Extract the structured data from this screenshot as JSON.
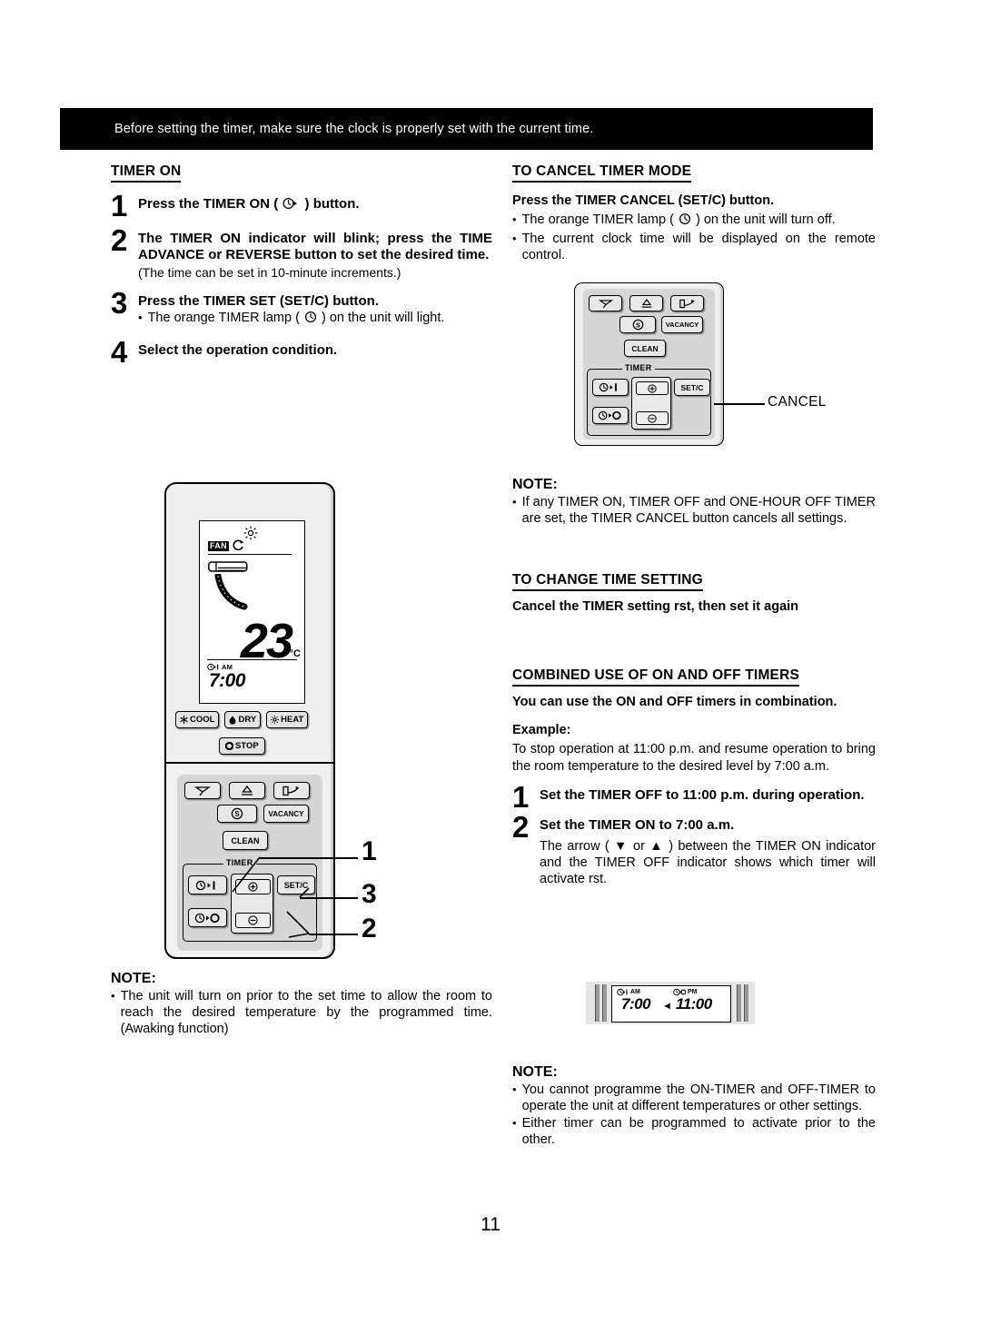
{
  "banner": {
    "text": "Before setting the timer, make sure the clock is properly set with the current time."
  },
  "left": {
    "heading": "TIMER ON",
    "steps": [
      {
        "num": "1",
        "text_before": "Press the TIMER ON (",
        "icon": "timer-on-clock-icon",
        "text_after": ") button.",
        "sub": ""
      },
      {
        "num": "2",
        "text": "The TIMER ON indicator will blink; press the TIME ADVANCE or REVERSE button to set the desired time.",
        "sub": "(The time can be set in 10-minute increments.)"
      },
      {
        "num": "3",
        "text": "Press the TIMER SET (SET/C) button.",
        "sub_before": "The orange TIMER lamp (",
        "sub_icon": "clock-icon",
        "sub_after": ") on the unit will light."
      },
      {
        "num": "4",
        "text": "Select the operation condition.",
        "sub": ""
      }
    ],
    "note": {
      "heading": "NOTE:",
      "bullets": [
        "The unit will turn on prior to the set time to allow the room to reach the desired temperature by the programmed time. (Awaking function)"
      ]
    }
  },
  "right": {
    "cancel_section": {
      "heading": "TO CANCEL TIMER MODE",
      "lead": "Press the TIMER CANCEL (SET/C) button.",
      "bullet1_before": "The orange TIMER lamp (",
      "bullet1_icon": "clock-icon",
      "bullet1_after": ") on the unit will turn off.",
      "bullet2": "The current clock time will be displayed on the remote control."
    },
    "callout_cancel": "CANCEL",
    "note1": {
      "heading": "NOTE:",
      "bullets": [
        "If any TIMER ON, TIMER OFF and ONE-HOUR OFF TIMER are set, the TIMER CANCEL button cancels all settings."
      ]
    },
    "change_section": {
      "heading": "TO CHANGE TIME SETTING",
      "lead": "Cancel the TIMER setting  rst, then set it again"
    },
    "combined_section": {
      "heading": "COMBINED USE OF ON AND OFF TIMERS",
      "lead": "You can use the ON and OFF timers in combination.",
      "example_label": "Example:",
      "example_text": "To stop operation at 11:00 p.m. and resume operation to bring the room temperature to the desired level by 7:00 a.m.",
      "steps": [
        {
          "num": "1",
          "text": "Set the TIMER OFF to 11:00 p.m. during operation.",
          "sub": ""
        },
        {
          "num": "2",
          "text": "Set the TIMER ON to 7:00 a.m.",
          "sub_a": "The arrow (",
          "sub_b": "or",
          "sub_c": ") between the TIMER ON indicator and the TIMER OFF indicator shows which timer will activate  rst."
        }
      ]
    },
    "note2": {
      "heading": "NOTE:",
      "bullets": [
        "You cannot programme the ON-TIMER and OFF-TIMER to operate the unit at different temperatures or other settings.",
        "Either timer can be programmed to activate prior to the other."
      ]
    }
  },
  "remote_big": {
    "lcd": {
      "fan_label": "FAN",
      "temperature": "23",
      "temp_unit": "°C",
      "timer_am_label": "AM",
      "timer_time": "7:00"
    },
    "mode_buttons": [
      {
        "label": "COOL",
        "icon": "snowflake-icon"
      },
      {
        "label": "DRY",
        "icon": "water-drop-icon"
      },
      {
        "label": "HEAT",
        "icon": "sun-icon"
      }
    ],
    "stop_button": {
      "label": "STOP",
      "icon": "circle-icon"
    },
    "panel_buttons": {
      "row1": [
        {
          "name": "louver-down-icon",
          "label": ""
        },
        {
          "name": "louver-up-icon",
          "label": ""
        },
        {
          "name": "door-swing-icon",
          "label": ""
        }
      ],
      "row2": [
        {
          "name": "s-circle-icon",
          "label": ""
        },
        {
          "name": "vacancy-button",
          "label": "VACANCY"
        }
      ],
      "clean": "CLEAN",
      "timer_label": "TIMER",
      "timer_on": "timer-on-icon",
      "timer_off": "timer-off-icon",
      "plus": "+",
      "minus": "−",
      "setc": "SET/C"
    },
    "callouts": [
      "1",
      "3",
      "2"
    ]
  },
  "remote_small": {
    "row2_vacancy": "VACANCY",
    "clean": "CLEAN",
    "timer_label": "TIMER",
    "setc": "SET/C"
  },
  "bottom_lcd": {
    "on_label": "AM",
    "on_time": "7:00",
    "off_label": "PM",
    "off_time": "11:00",
    "arrow": "◄"
  },
  "page_number": "11"
}
